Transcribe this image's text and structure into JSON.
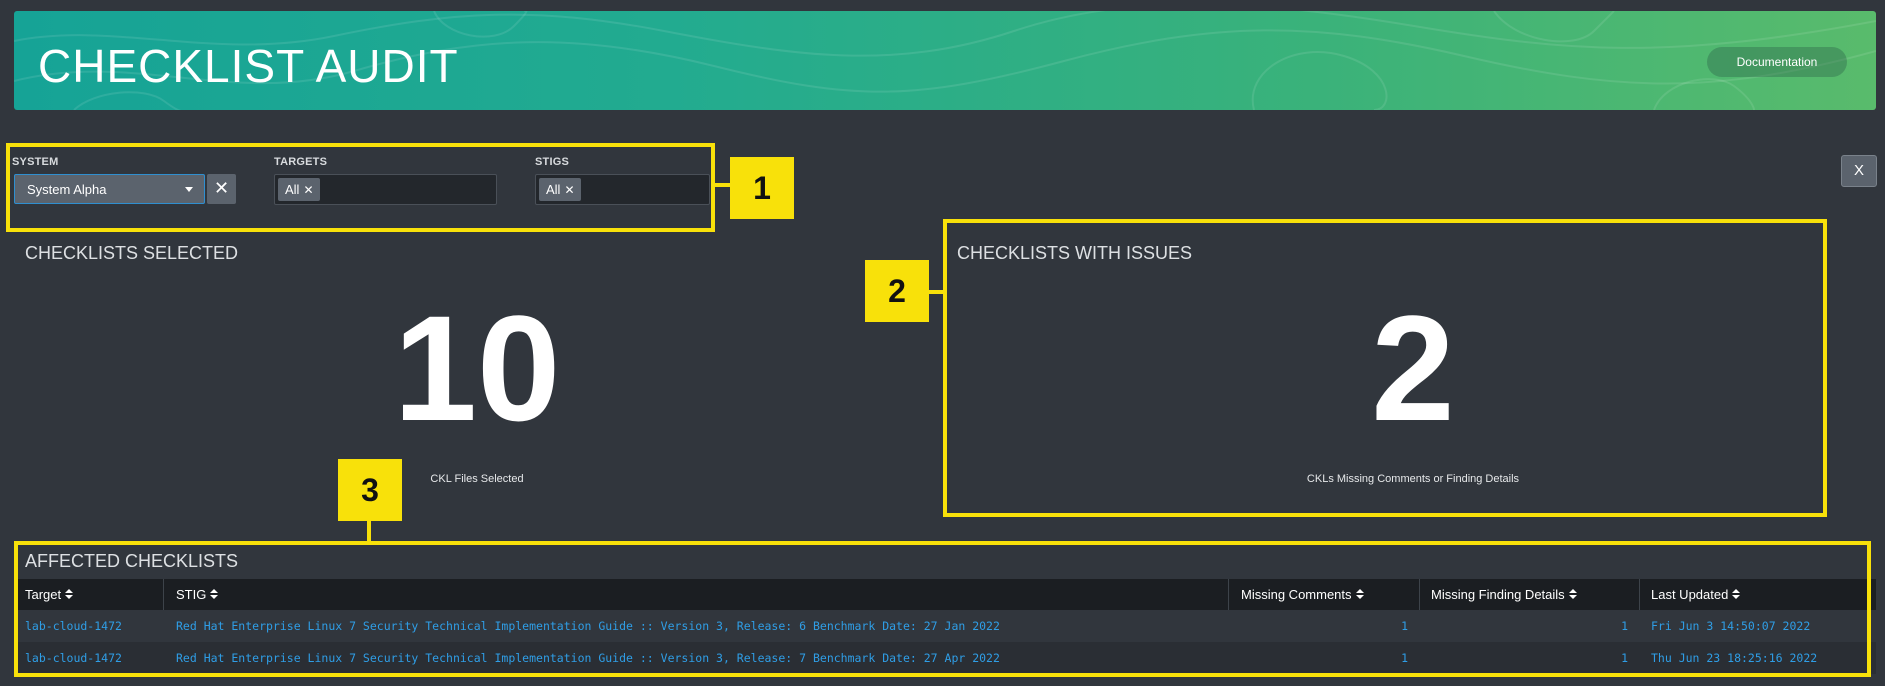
{
  "header": {
    "title": "CHECKLIST AUDIT",
    "documentation_label": "Documentation"
  },
  "filters": {
    "system": {
      "label": "SYSTEM",
      "value": "System Alpha",
      "clear_icon": "close-icon"
    },
    "targets": {
      "label": "TARGETS",
      "token": "All"
    },
    "stigs": {
      "label": "STIGS",
      "token": "All"
    },
    "token_remove_glyph": "✕",
    "clear_glyph": "✕",
    "close_panel_label": "X"
  },
  "callouts": [
    "1",
    "2",
    "3"
  ],
  "callout_color": "#f8e10a",
  "panels": {
    "selected": {
      "title": "CHECKLISTS SELECTED",
      "value": "10",
      "caption": "CKL Files Selected"
    },
    "issues": {
      "title": "CHECKLISTS WITH ISSUES",
      "value": "2",
      "caption": "CKLs Missing Comments or Finding Details"
    }
  },
  "table": {
    "title": "AFFECTED CHECKLISTS",
    "columns": [
      "Target",
      "STIG",
      "Missing Comments",
      "Missing Finding Details",
      "Last Updated"
    ],
    "rows": [
      {
        "target": "lab-cloud-1472",
        "stig": "Red Hat Enterprise Linux 7 Security Technical Implementation Guide :: Version 3, Release: 6 Benchmark Date: 27 Jan 2022",
        "missing_comments": "1",
        "missing_finding_details": "1",
        "last_updated": "Fri Jun  3 14:50:07 2022"
      },
      {
        "target": "lab-cloud-1472",
        "stig": "Red Hat Enterprise Linux 7 Security Technical Implementation Guide :: Version 3, Release: 7 Benchmark Date: 27 Apr 2022",
        "missing_comments": "1",
        "missing_finding_details": "1",
        "last_updated": "Thu Jun 23 18:25:16 2022"
      }
    ]
  },
  "colors": {
    "background": "#31363d",
    "link": "#2f9ee6",
    "banner_start": "#16a396",
    "banner_end": "#59bb6c"
  }
}
